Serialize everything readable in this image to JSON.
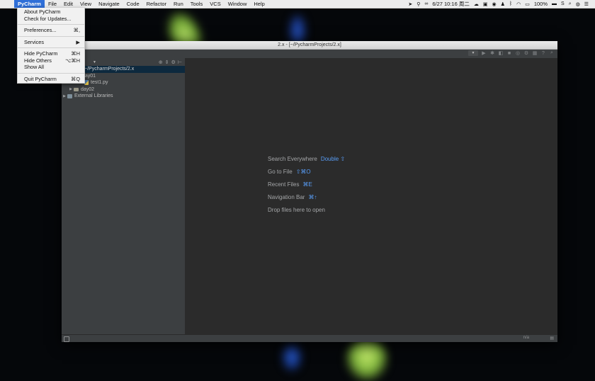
{
  "menubar": {
    "app": "PyCharm",
    "items": [
      "File",
      "Edit",
      "View",
      "Navigate",
      "Code",
      "Refactor",
      "Run",
      "Tools",
      "VCS",
      "Window",
      "Help"
    ],
    "datetime": "6/27 10:16 周二",
    "battery": "100%"
  },
  "app_menu": {
    "about": "About PyCharm",
    "check_updates": "Check for Updates...",
    "preferences": "Preferences...",
    "preferences_shortcut": "⌘,",
    "services": "Services",
    "hide": "Hide PyCharm",
    "hide_shortcut": "⌘H",
    "hide_others": "Hide Others",
    "hide_others_shortcut": "⌥⌘H",
    "show_all": "Show All",
    "quit": "Quit PyCharm",
    "quit_shortcut": "⌘Q"
  },
  "window": {
    "title": "2.x - [~/PycharmProjects/2.x]"
  },
  "project_tree": {
    "root": "~/PycharmProjects/2.x",
    "folder1": "day01",
    "file1": "test1.py",
    "folder2": "day02",
    "libs": "External Libraries"
  },
  "editor_hints": [
    {
      "label": "Search Everywhere",
      "key": "Double ⇧"
    },
    {
      "label": "Go to File",
      "key": "⇧⌘O"
    },
    {
      "label": "Recent Files",
      "key": "⌘E"
    },
    {
      "label": "Navigation Bar",
      "key": "⌘↑"
    },
    {
      "label": "Drop files here to open",
      "key": ""
    }
  ],
  "statusbar": {
    "position": "n/a"
  }
}
